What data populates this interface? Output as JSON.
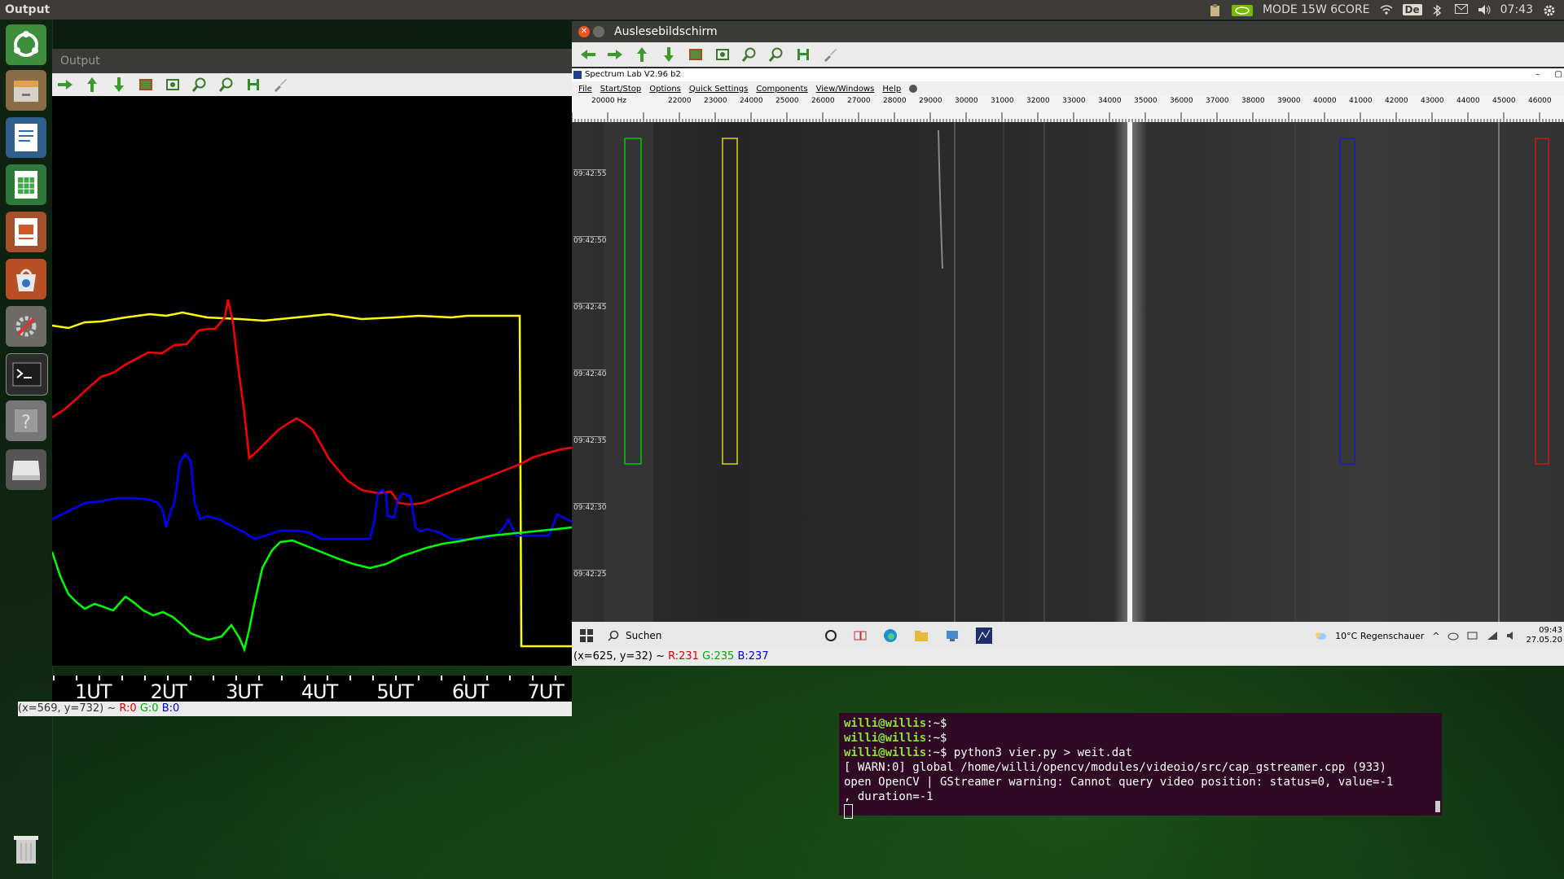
{
  "topbar": {
    "app_title": "Output",
    "gpu_mode": "MODE 15W 6CORE",
    "keyboard_layout": "De",
    "clock": "07:43"
  },
  "output_window": {
    "title": "Output",
    "ut_labels": [
      "1UT",
      "2UT",
      "3UT",
      "4UT",
      "5UT",
      "6UT",
      "7UT"
    ],
    "status_coords": "(x=569, y=732) ~ ",
    "status_r": "R:0",
    "status_g": "G:0",
    "status_b": "B:0",
    "colors": {
      "yellow": "#ffff00",
      "red": "#ff0000",
      "blue": "#0000ff",
      "green": "#00ff00"
    }
  },
  "spectrum_window": {
    "title": "Auslesebildschirm",
    "inner_title": "Spectrum Lab V2.96 b2",
    "menu": [
      "File",
      "Start/Stop",
      "Options",
      "Quick Settings",
      "Components",
      "View/Windows",
      "Help"
    ],
    "freq_labels": [
      "20000 Hz",
      "22000",
      "23000",
      "24000",
      "25000",
      "26000",
      "27000",
      "28000",
      "29000",
      "30000",
      "31000",
      "32000",
      "33000",
      "34000",
      "35000",
      "36000",
      "37000",
      "38000",
      "39000",
      "40000",
      "41000",
      "42000",
      "43000",
      "44000",
      "45000",
      "46000"
    ],
    "time_labels": [
      "09:42:55",
      "09:42:50",
      "09:42:45",
      "09:42:40",
      "09:42:35",
      "09:42:30",
      "09:42:25"
    ],
    "taskbar": {
      "search": "Suchen",
      "weather": "10°C  Regenschauer",
      "clock": "09:43",
      "date": "27.05.20"
    },
    "status_coords": "(x=625, y=32) ~ ",
    "status_r": "R:231",
    "status_g": "G:235",
    "status_b": "B:237"
  },
  "terminal": {
    "lines": [
      {
        "prompt": "willi@willis",
        "suffix": ":~$",
        "cmd": ""
      },
      {
        "prompt": "willi@willis",
        "suffix": ":~$",
        "cmd": ""
      },
      {
        "prompt": "willi@willis",
        "suffix": ":~$",
        "cmd": " python3 vier.py > weit.dat"
      }
    ],
    "output": [
      "[ WARN:0] global /home/willi/opencv/modules/videoio/src/cap_gstreamer.cpp (933)",
      "open OpenCV | GStreamer warning: Cannot query video position: status=0, value=-1",
      ", duration=-1"
    ]
  }
}
